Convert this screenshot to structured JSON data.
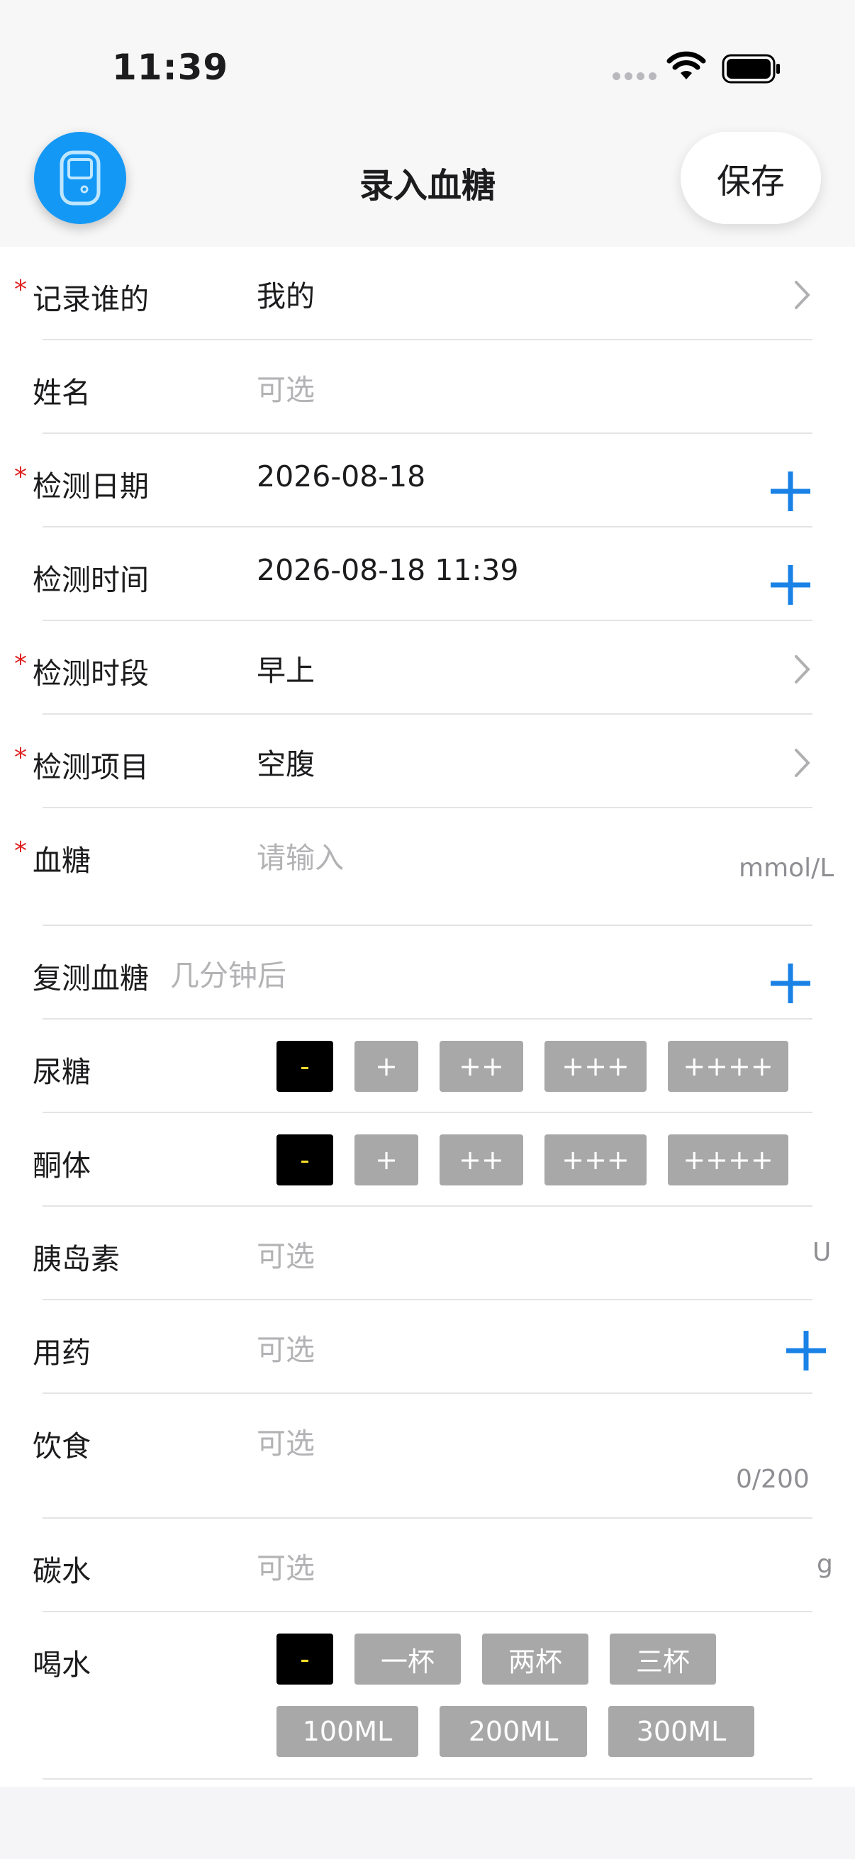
{
  "status_bar": {
    "time": "11:39"
  },
  "nav": {
    "title": "录入血糖",
    "save_label": "保存",
    "app_icon": "glucose-meter-icon"
  },
  "colors": {
    "accent_blue": "#1a82e6",
    "required_red": "#e02020",
    "chip_selected_bg": "#000000",
    "chip_selected_text": "#f2dc2c",
    "chip_bg": "#a8a8a8"
  },
  "form": {
    "required_mark": "*",
    "who": {
      "label": "记录谁的",
      "value": "我的"
    },
    "name": {
      "label": "姓名",
      "placeholder": "可选"
    },
    "date": {
      "label": "检测日期",
      "value": "2026-08-18"
    },
    "time": {
      "label": "检测时间",
      "value": "2026-08-18 11:39"
    },
    "period": {
      "label": "检测时段",
      "value": "早上"
    },
    "item": {
      "label": "检测项目",
      "value": "空腹"
    },
    "glucose": {
      "label": "血糖",
      "placeholder": "请输入",
      "unit": "mmol/L"
    },
    "retest": {
      "label": "复测血糖",
      "placeholder": "几分钟后"
    },
    "urine_sugar": {
      "label": "尿糖",
      "options": [
        "-",
        "+",
        "++",
        "+++",
        "++++"
      ],
      "selected": "-"
    },
    "ketone": {
      "label": "酮体",
      "options": [
        "-",
        "+",
        "++",
        "+++",
        "++++"
      ],
      "selected": "-"
    },
    "insulin": {
      "label": "胰岛素",
      "placeholder": "可选",
      "unit": "U"
    },
    "medication": {
      "label": "用药",
      "placeholder": "可选"
    },
    "diet": {
      "label": "饮食",
      "placeholder": "可选",
      "counter": "0/200"
    },
    "carbs": {
      "label": "碳水",
      "placeholder": "可选",
      "unit": "g"
    },
    "water": {
      "label": "喝水",
      "options_row1": [
        "-",
        "一杯",
        "两杯",
        "三杯"
      ],
      "options_row2": [
        "100ML",
        "200ML",
        "300ML"
      ],
      "selected": "-"
    }
  }
}
